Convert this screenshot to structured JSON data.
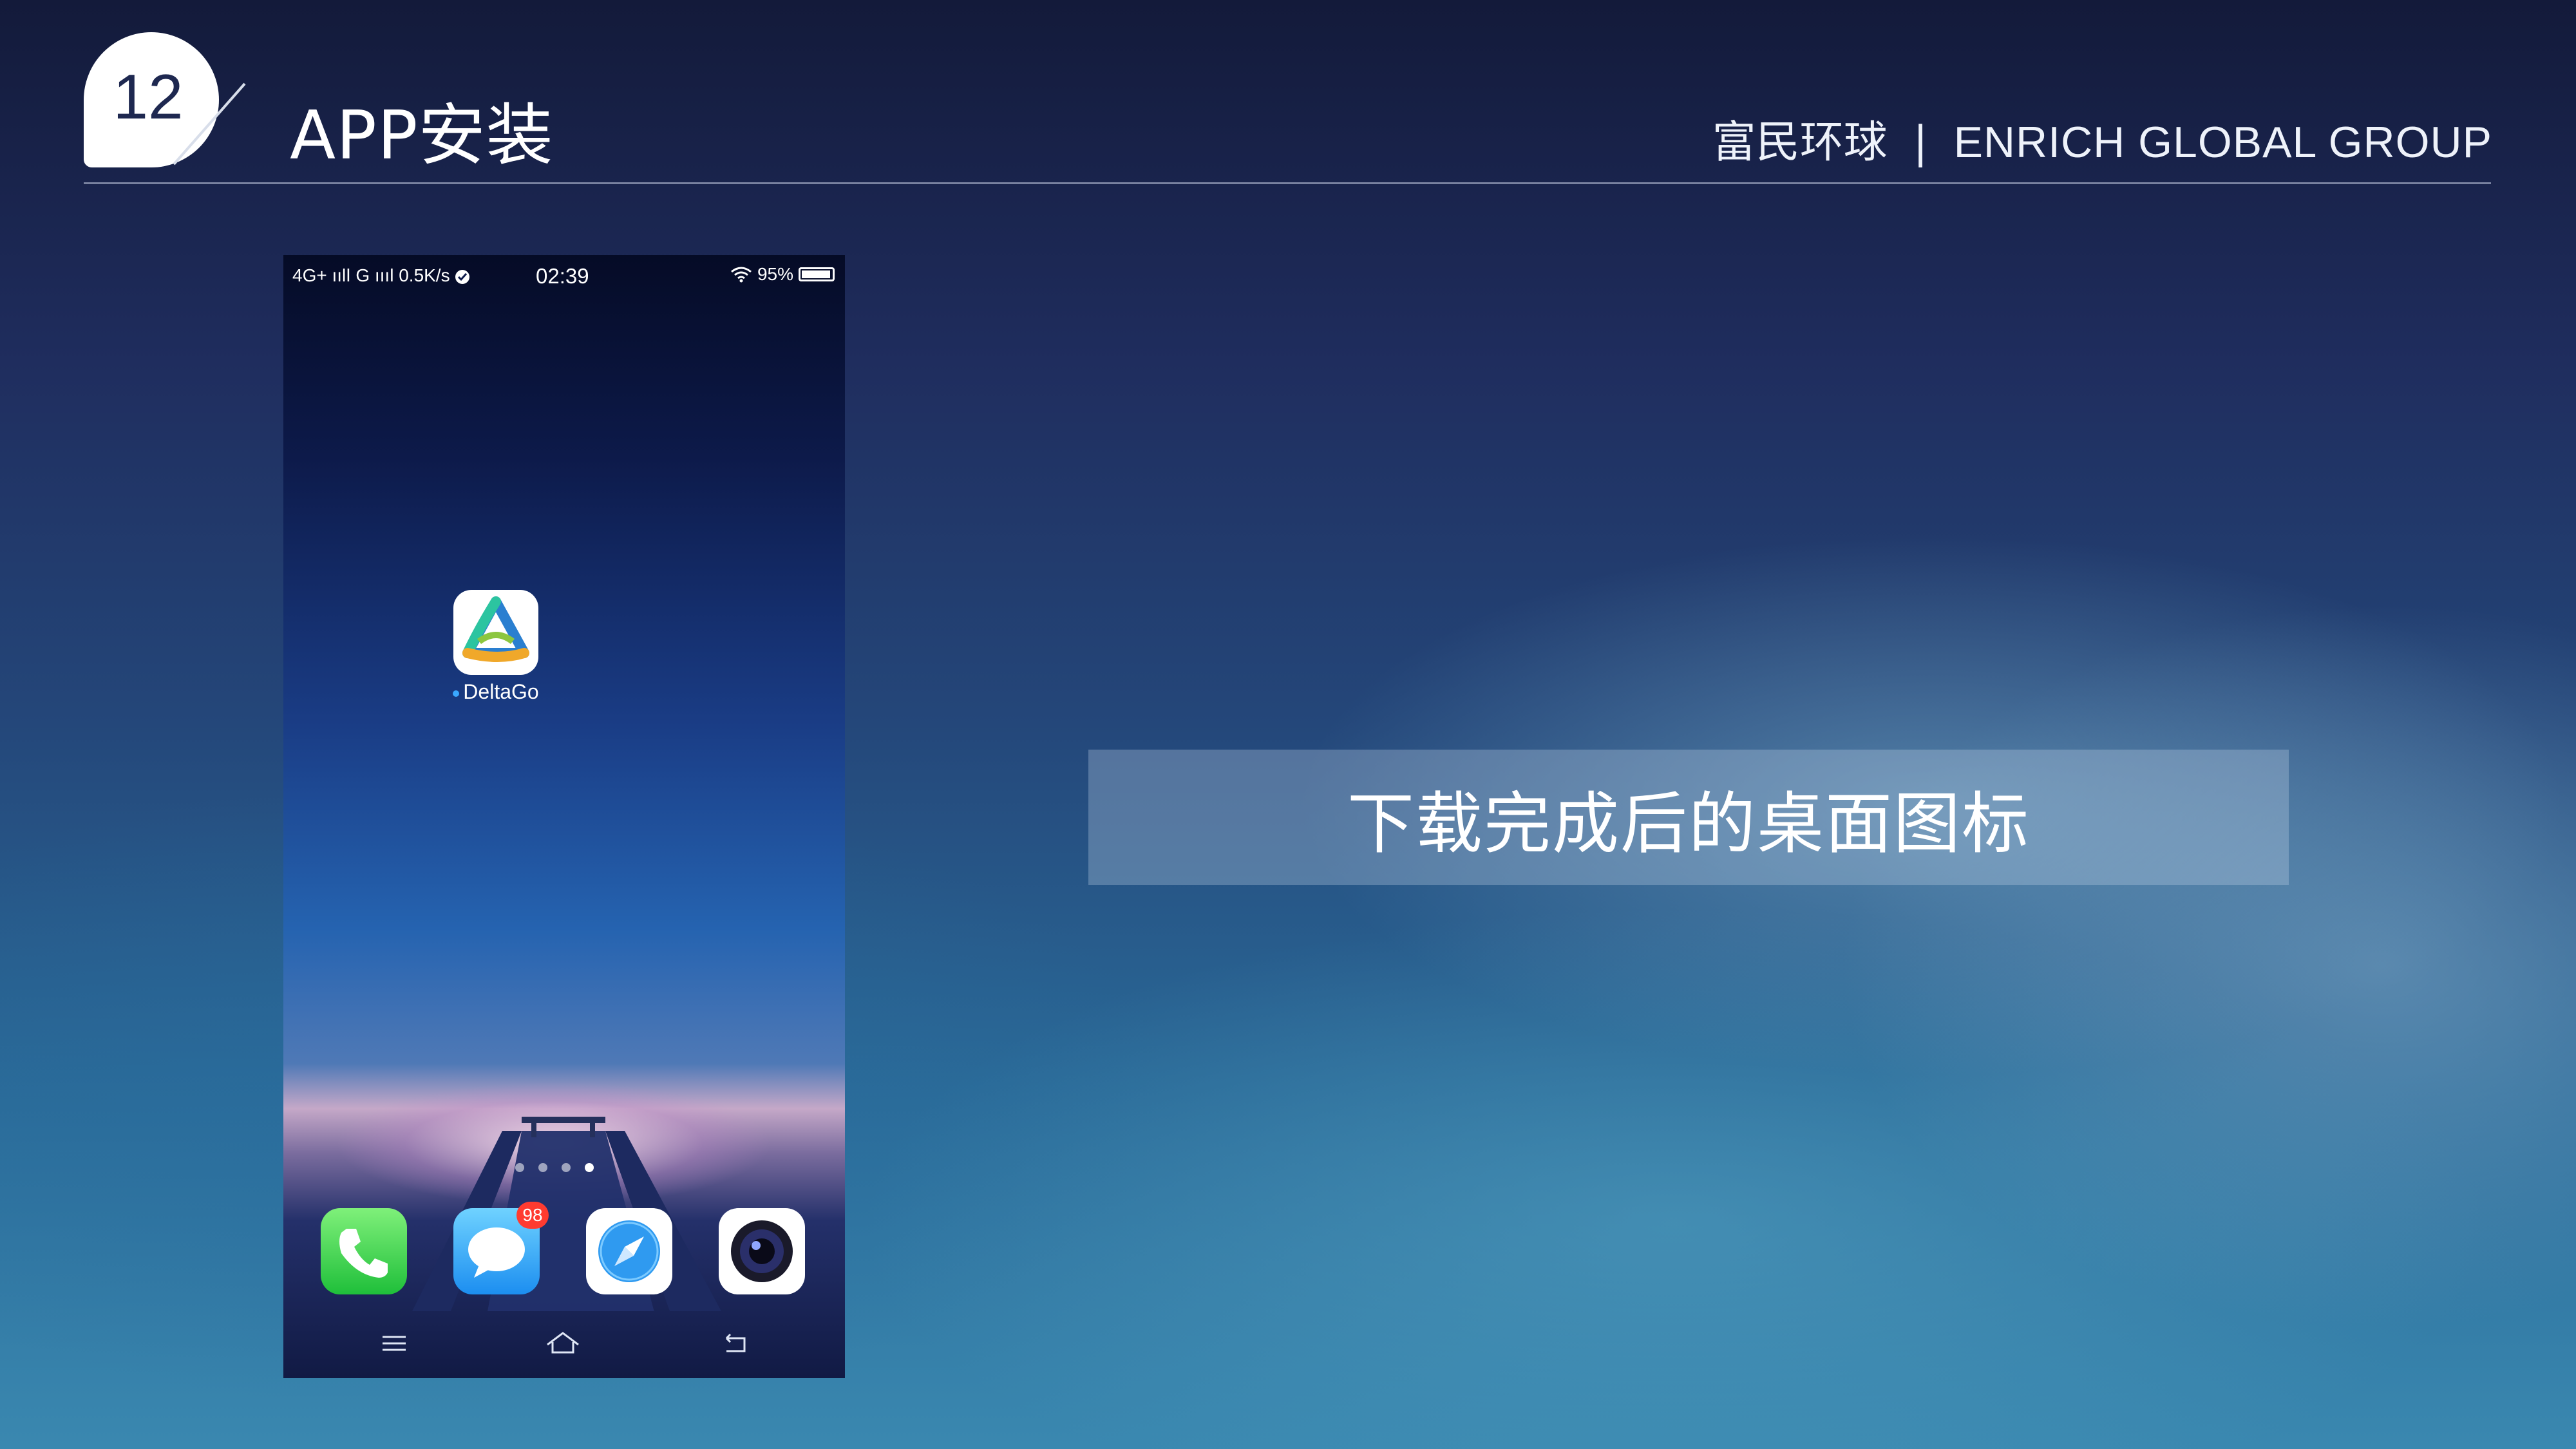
{
  "slide": {
    "number": "12",
    "title": "APP安装",
    "company_cn": "富民环球",
    "separator": "|",
    "company_en": "ENRICH GLOBAL GROUP",
    "caption": "下载完成后的桌面图标"
  },
  "phone": {
    "status_left": "4G+ ıılǀ G ıııl 0.5K/s",
    "time": "02:39",
    "battery": "95%",
    "app_label": "DeltaGo",
    "message_badge": "98",
    "dock": [
      "phone-app-icon",
      "messages-app-icon",
      "browser-app-icon",
      "camera-app-icon"
    ],
    "nav": [
      "menu-icon",
      "home-icon",
      "back-icon"
    ]
  },
  "colors": {
    "badge_bg": "#ffffff",
    "badge_text": "#1e2850",
    "caption_bg": "rgba(200,215,235,0.30)"
  }
}
